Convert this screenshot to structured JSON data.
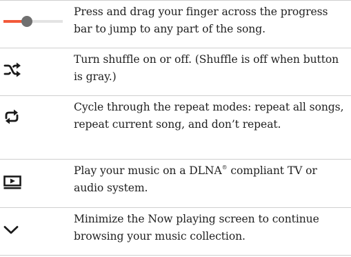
{
  "rows": [
    {
      "icon": "progress-slider-icon",
      "progress": 0.4,
      "text": "Press and drag your finger across the progress bar to jump to any part of the song."
    },
    {
      "icon": "shuffle-icon",
      "text": "Turn shuffle on or off. (Shuffle is off when button is gray.)"
    },
    {
      "icon": "repeat-icon",
      "text": "Cycle through the repeat modes: repeat all songs, repeat current song, and don’t repeat."
    },
    {
      "icon": "play-on-screen-icon",
      "text_before": "Play your music on a DLNA",
      "sup": "®",
      "text_after": " compliant TV or audio system."
    },
    {
      "icon": "chevron-down-icon",
      "text": "Minimize the Now playing screen to continue browsing your music collection."
    }
  ],
  "colors": {
    "accent": "#f2593a",
    "track": "#e3e3e3",
    "knob": "#707070",
    "icon": "#1a1a1a",
    "divider": "#cfcfcf",
    "text": "#1f1f1f"
  }
}
